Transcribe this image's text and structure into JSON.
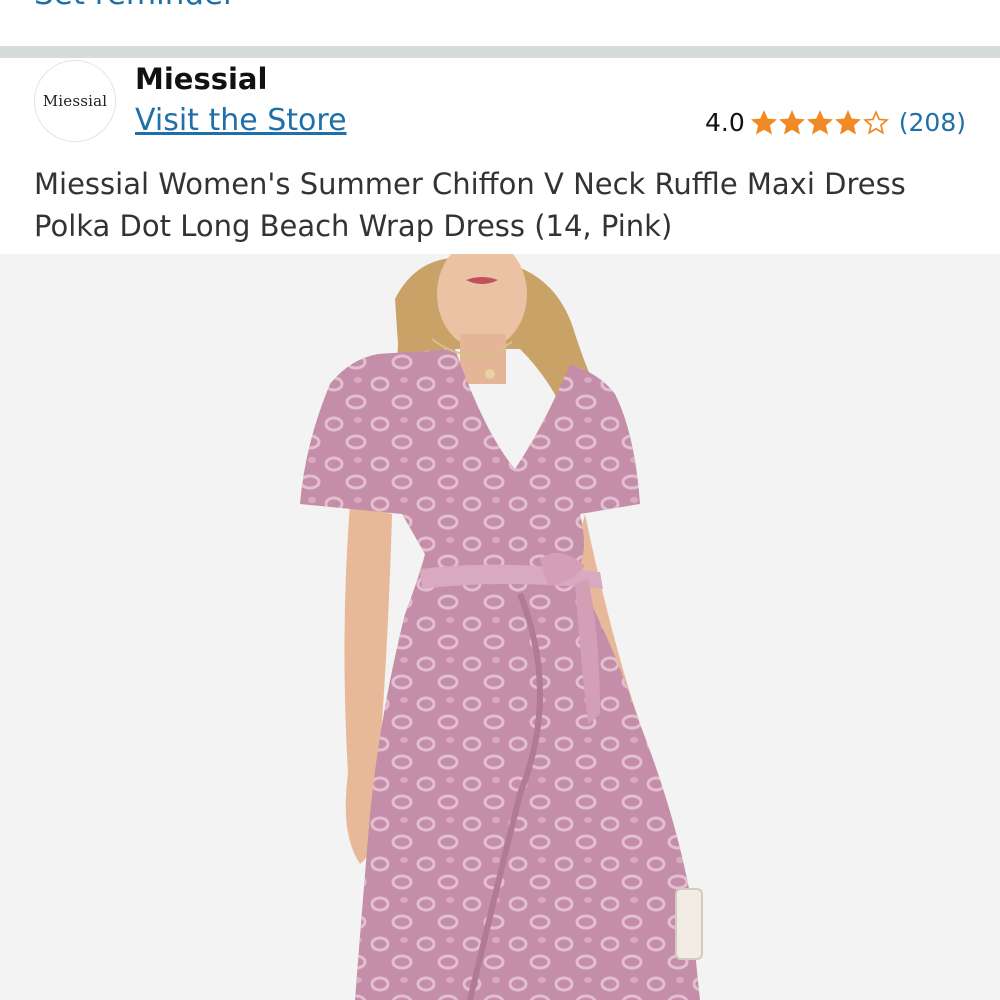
{
  "header": {
    "reminder_label": "Set reminder"
  },
  "brand": {
    "logo_text": "Miessial",
    "name": "Miessial",
    "visit_store_label": "Visit the Store"
  },
  "rating": {
    "value": "4.0",
    "stars": 4.0,
    "max_stars": 5,
    "count": "(208)",
    "star_color": "#f08a24"
  },
  "product": {
    "title": "Miessial Women's Summer Chiffon V Neck Ruffle Maxi Dress Polka Dot Long Beach Wrap Dress (14, Pink)"
  },
  "colors": {
    "link": "#1f6fa8",
    "divider": "#d5dcd9",
    "image_bg": "#f3f3f3",
    "dress": "#c48ea8"
  }
}
